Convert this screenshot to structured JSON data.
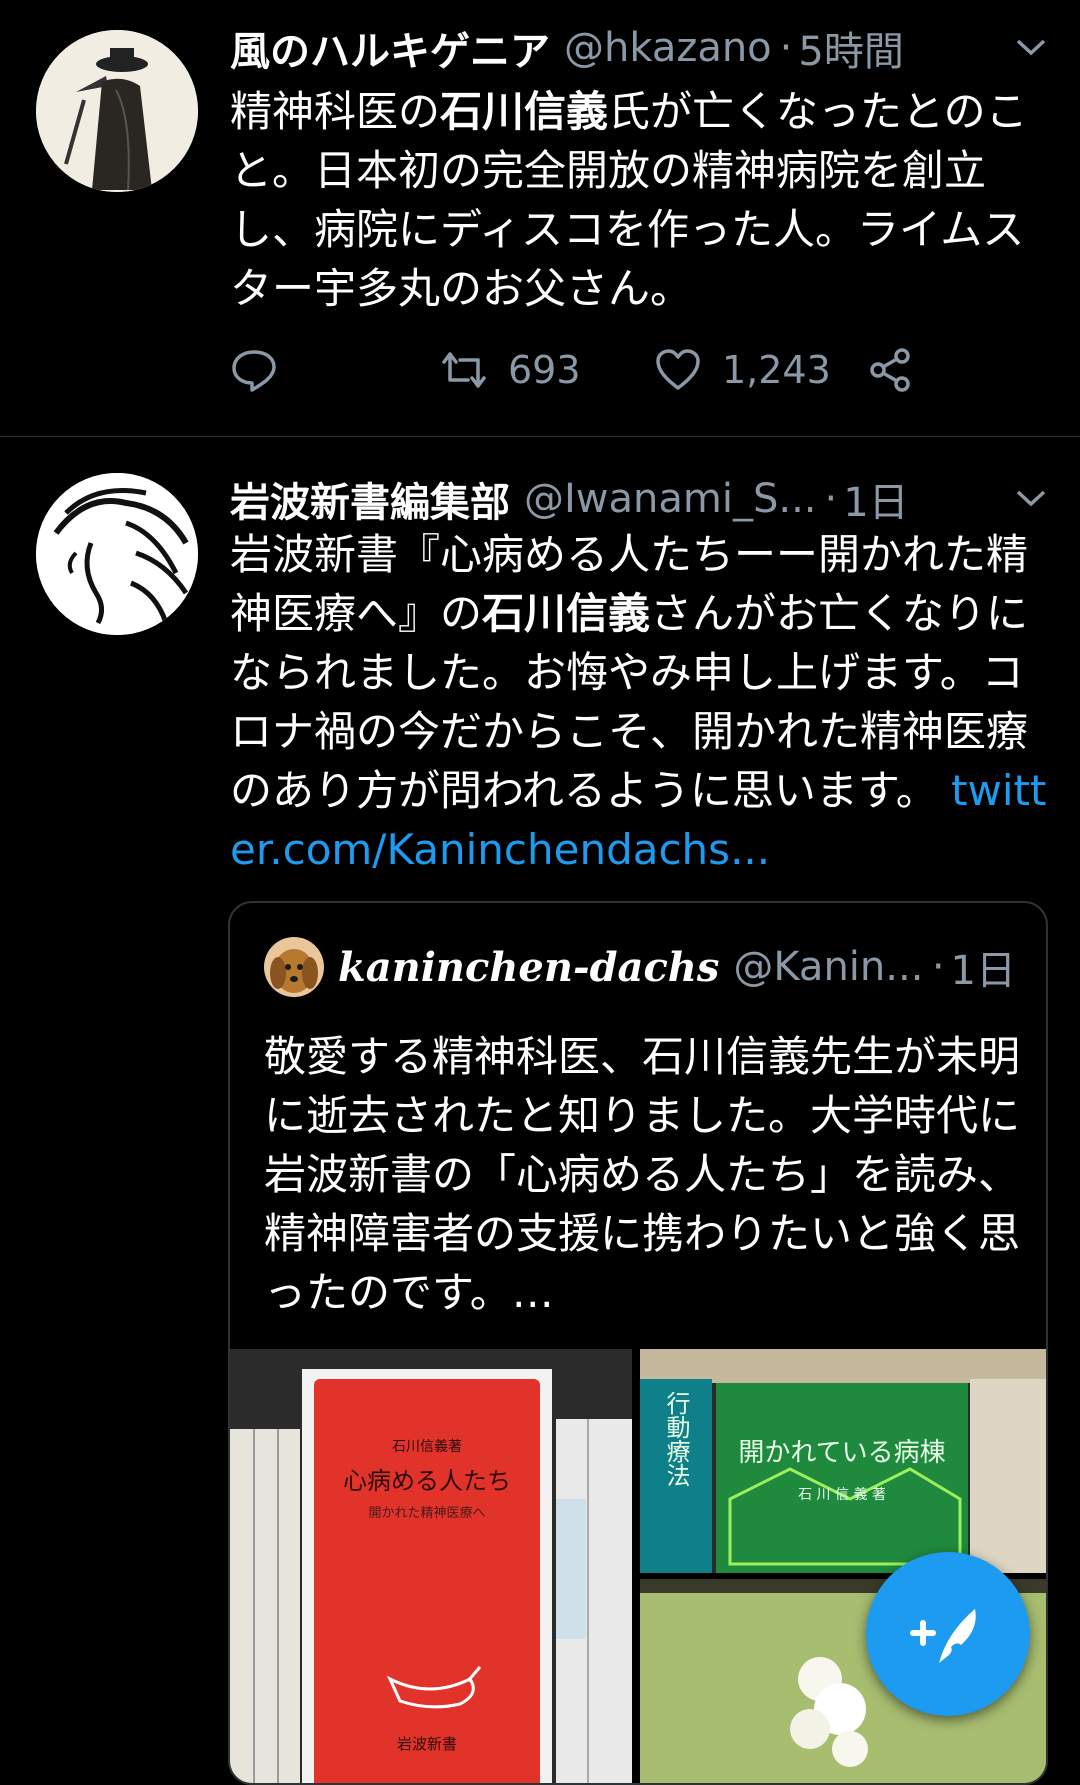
{
  "tweet1": {
    "name": "風のハルキゲニア",
    "handle": "@hkazano",
    "sep": "·",
    "time": "5時間",
    "text_a": "精神科医の",
    "text_bold": "石川信義",
    "text_b": "氏が亡くなったとのこと。日本初の完全開放の精神病院を創立し、病院にディスコを作った人。ライムスター宇多丸のお父さん。",
    "retweets": "693",
    "likes": "1,243"
  },
  "tweet2": {
    "name": "岩波新書編集部",
    "handle": "@Iwanami_S...",
    "sep": "·",
    "time": "1日",
    "text_a": "岩波新書『心病める人たちーー開かれた精神医療へ』の",
    "text_bold": "石川信義",
    "text_b": "さんがお亡くなりになられました。お悔やみ申し上げます。コロナ禍の今だからこそ、開かれた精神医療のあり方が問われるように思います。",
    "link": "twitter.com/Kaninchendachs..."
  },
  "quote": {
    "name": "kaninchen-dachs",
    "handle": "@Kanin...",
    "sep": "·",
    "time": "1日",
    "text": "敬愛する精神科医、石川信義先生が未明に逝去されたと知りました。大学時代に岩波新書の「心病める人たち」を読み、精神障害者の支援に携わりたいと強く思ったのです。…"
  },
  "media": {
    "m1": {
      "title": "心病める人たち",
      "subtitle": "開かれた精神医療へ",
      "author": "石川信義著",
      "publisher": "岩波新書"
    },
    "m2": {
      "title": "開かれている病棟",
      "author": "石 川 信 義 著",
      "spine": "行動療法"
    }
  },
  "icons": [
    "reply-icon",
    "retweet-icon",
    "like-icon",
    "share-icon",
    "chevron-down-icon",
    "compose-icon"
  ],
  "colors": {
    "accent": "#1d9bf0",
    "muted": "#8b98a5",
    "background": "#000000"
  }
}
